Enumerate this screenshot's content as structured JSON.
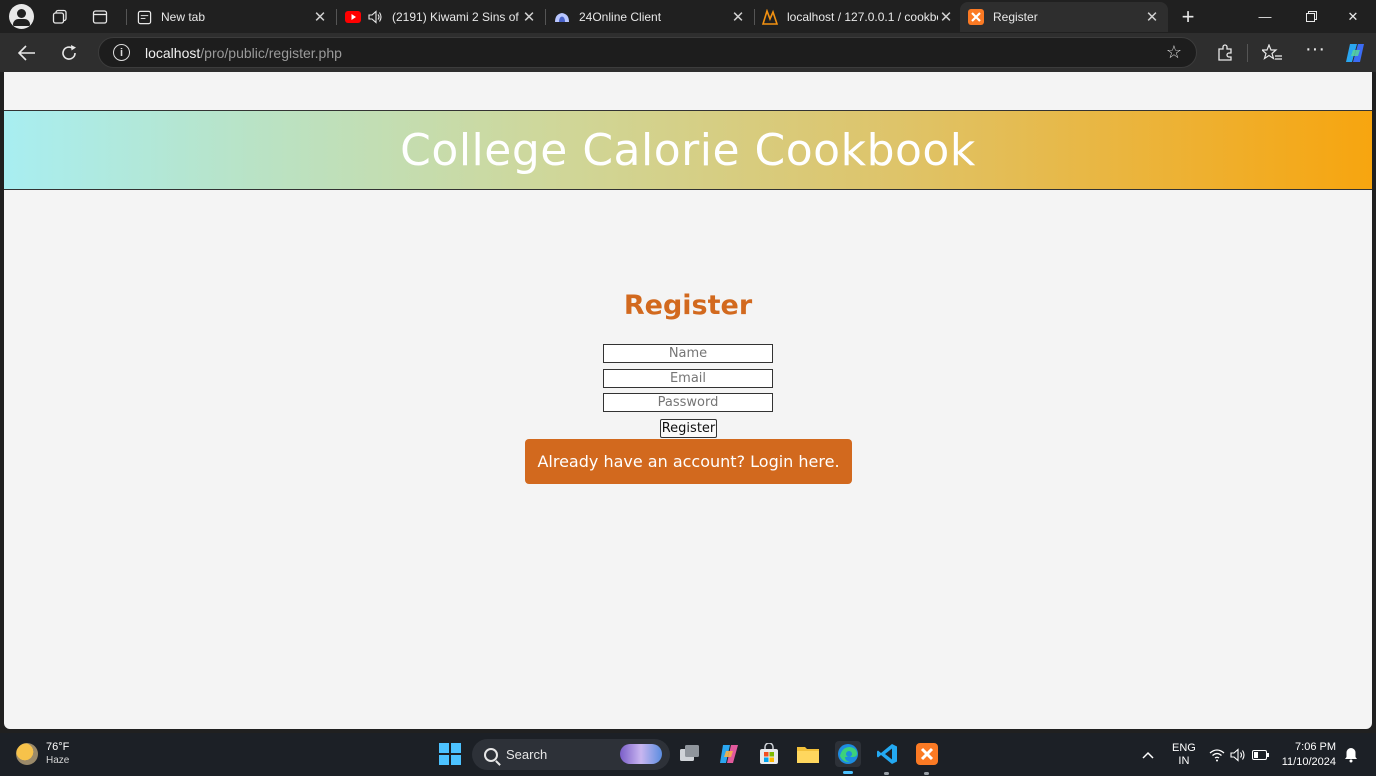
{
  "browser": {
    "tabs": [
      {
        "title": "New tab",
        "icon": "new-tab-icon"
      },
      {
        "title": "(2191) Kiwami 2 Sins of",
        "icon": "youtube-icon",
        "audio": true
      },
      {
        "title": "24Online Client",
        "icon": "cloud-icon"
      },
      {
        "title": "localhost / 127.0.0.1 / cookbo",
        "icon": "phpmyadmin-icon"
      },
      {
        "title": "Register",
        "icon": "xampp-icon",
        "active": true
      }
    ],
    "address": {
      "host": "localhost",
      "path": "/pro/public/register.php"
    }
  },
  "page": {
    "banner_title": "College Calorie Cookbook",
    "form": {
      "title": "Register",
      "name_placeholder": "Name",
      "email_placeholder": "Email",
      "password_placeholder": "Password",
      "submit_label": "Register",
      "login_link": "Already have an account? Login here."
    },
    "colors": {
      "accent": "#d2691e",
      "banner_start": "#a8eef1",
      "banner_end": "#f7a50f",
      "page_bg": "#f4f4f4"
    }
  },
  "taskbar": {
    "weather": {
      "temp": "76°F",
      "condition": "Haze"
    },
    "search_label": "Search",
    "language": {
      "line1": "ENG",
      "line2": "IN"
    },
    "clock": {
      "time": "7:06 PM",
      "date": "11/10/2024"
    }
  }
}
